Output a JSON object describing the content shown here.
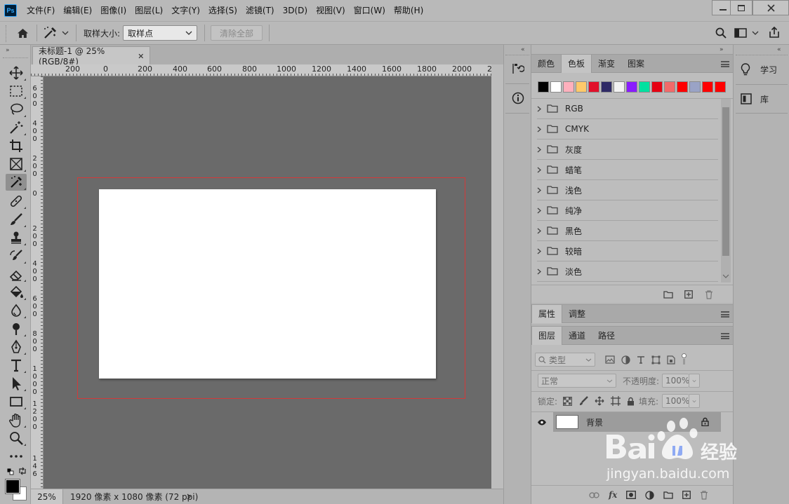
{
  "app": {
    "logo": "Ps",
    "menus": [
      "文件(F)",
      "编辑(E)",
      "图像(I)",
      "图层(L)",
      "文字(Y)",
      "选择(S)",
      "滤镜(T)",
      "3D(D)",
      "视图(V)",
      "窗口(W)",
      "帮助(H)"
    ]
  },
  "options_bar": {
    "sample_size_label": "取样大小:",
    "sample_size_value": "取样点",
    "clear_all_label": "清除全部"
  },
  "document": {
    "tab_title": "未标题-1 @ 25%(RGB/8#)",
    "h_ruler_labels": [
      "200",
      "0",
      "200",
      "400",
      "600",
      "800",
      "1000",
      "1200",
      "1400",
      "1600",
      "1800",
      "2000",
      "2"
    ],
    "v_ruler_labels": [
      "6\n0\n0",
      "4\n0\n0",
      "2\n0\n0",
      "0",
      "2\n0\n0",
      "4\n0\n0",
      "6\n0\n0",
      "8\n0\n0",
      "1\n0\n0\n0",
      "1\n2\n0\n0",
      "1\n4\n6"
    ],
    "zoom": "25%",
    "doc_info": "1920 像素 x 1080 像素 (72 ppi)"
  },
  "colors": {
    "ruler_bg": "#c9c9c9",
    "canvas_bg": "#6a6a6a",
    "artboard": "#ffffff",
    "bleed_outline": "#d23a3a",
    "foreground": "#000000",
    "background": "#ffffff"
  },
  "side_col1": {
    "items": [
      {
        "icon": "history-icon"
      },
      {
        "icon": "info-icon"
      }
    ]
  },
  "side_col3": {
    "items": [
      {
        "icon": "lightbulb-icon",
        "label": "学习"
      },
      {
        "icon": "library-icon",
        "label": "库"
      }
    ]
  },
  "swatches_panel": {
    "tabs": [
      "颜色",
      "色板",
      "渐变",
      "图案"
    ],
    "active_tab": 1,
    "swatch_colors": [
      "#000000",
      "#ffffff",
      "#ffb0bd",
      "#ffc96a",
      "#e1102a",
      "#2f2a66",
      "#f2f2f2",
      "#8a1cff",
      "#00e1a0",
      "#e60012",
      "#f26a6a",
      "#ff0000",
      "#9aa3c6",
      "#ff0000",
      "#ff0000"
    ],
    "groups": [
      "RGB",
      "CMYK",
      "灰度",
      "蜡笔",
      "浅色",
      "纯净",
      "黑色",
      "较暗",
      "淡色"
    ]
  },
  "properties_panel": {
    "tabs": [
      "属性",
      "调整"
    ],
    "active_tab": 0
  },
  "layers_panel": {
    "tabs": [
      "图层",
      "通道",
      "路径"
    ],
    "active_tab": 0,
    "filter_label": "类型",
    "blend_mode": "正常",
    "opacity_label": "不透明度:",
    "opacity_value": "100%",
    "lock_label": "锁定:",
    "fill_label": "填充:",
    "fill_value": "100%",
    "layers": [
      {
        "name": "背景",
        "visible": true,
        "locked": true
      }
    ]
  }
}
